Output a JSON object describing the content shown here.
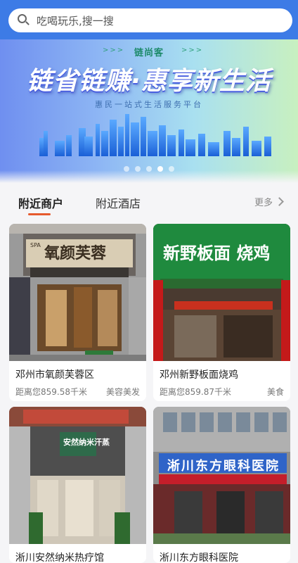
{
  "search": {
    "placeholder": "吃喝玩乐,搜一搜"
  },
  "banner": {
    "tag": "链尚客",
    "arrows": ">>>",
    "title": "链省链赚·惠享新生活",
    "subtitle": "惠民一站式生活服务平台",
    "slide_count": 5,
    "active_slide": 4
  },
  "tabs": [
    {
      "label": "附近商户",
      "active": true
    },
    {
      "label": "附近酒店",
      "active": false
    }
  ],
  "more_label": "更多",
  "merchants": [
    {
      "name": "邓州市氧颜芙蓉区",
      "distance": "距离您859.58千米",
      "category": "美容美发",
      "sign": "氧颜芙蓉",
      "sign_prefix": "SPA"
    },
    {
      "name": "邓州新野板面烧鸡",
      "distance": "距离您859.87千米",
      "category": "美食",
      "sign": "新野板面 烧鸡"
    },
    {
      "name": "淅川安然纳米热疗馆",
      "distance": "",
      "category": "",
      "sign": "安然纳米汗蒸"
    },
    {
      "name": "淅川东方眼科医院",
      "distance": "",
      "category": "",
      "sign": "淅川东方眼科医院"
    }
  ],
  "colors": {
    "header": "#3d7be6",
    "accent": "#e65a2e"
  }
}
